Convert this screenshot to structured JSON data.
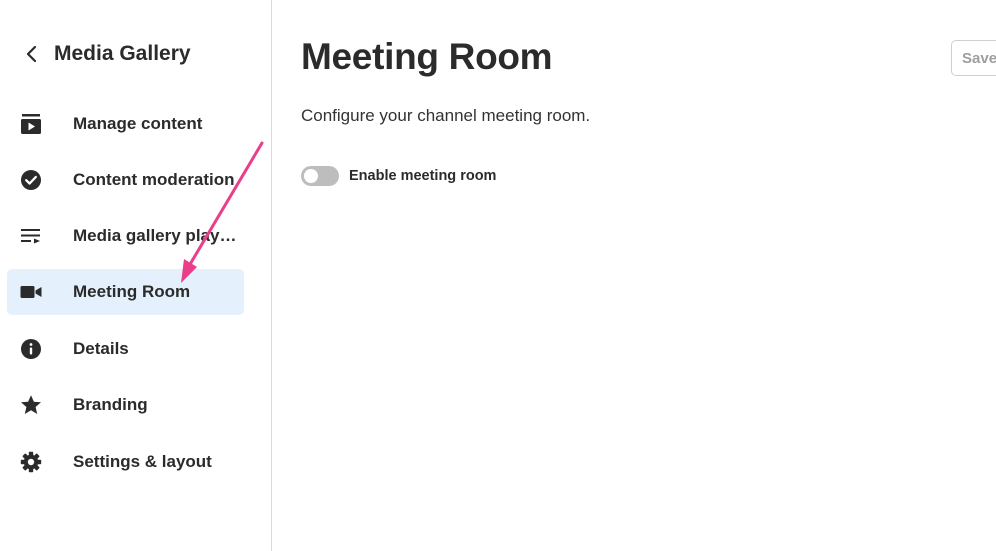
{
  "sidebar": {
    "back_label": "Media Gallery",
    "items": [
      {
        "label": "Manage content",
        "icon": "play-box-icon"
      },
      {
        "label": "Content moderation",
        "icon": "check-circle-icon"
      },
      {
        "label": "Media gallery play…",
        "icon": "playlist-icon"
      },
      {
        "label": "Meeting Room",
        "icon": "video-camera-icon",
        "active": true
      },
      {
        "label": "Details",
        "icon": "info-icon"
      },
      {
        "label": "Branding",
        "icon": "star-icon"
      },
      {
        "label": "Settings & layout",
        "icon": "gear-icon"
      }
    ]
  },
  "main": {
    "title": "Meeting Room",
    "description": "Configure your channel meeting room.",
    "toggle": {
      "label": "Enable meeting room",
      "enabled": false
    },
    "save_label": "Save"
  },
  "colors": {
    "active_bg": "#e5f0fd",
    "text": "#2b2b2b",
    "annotation_arrow": "#ea3d8a",
    "toggle_off": "#bdbdbd"
  }
}
